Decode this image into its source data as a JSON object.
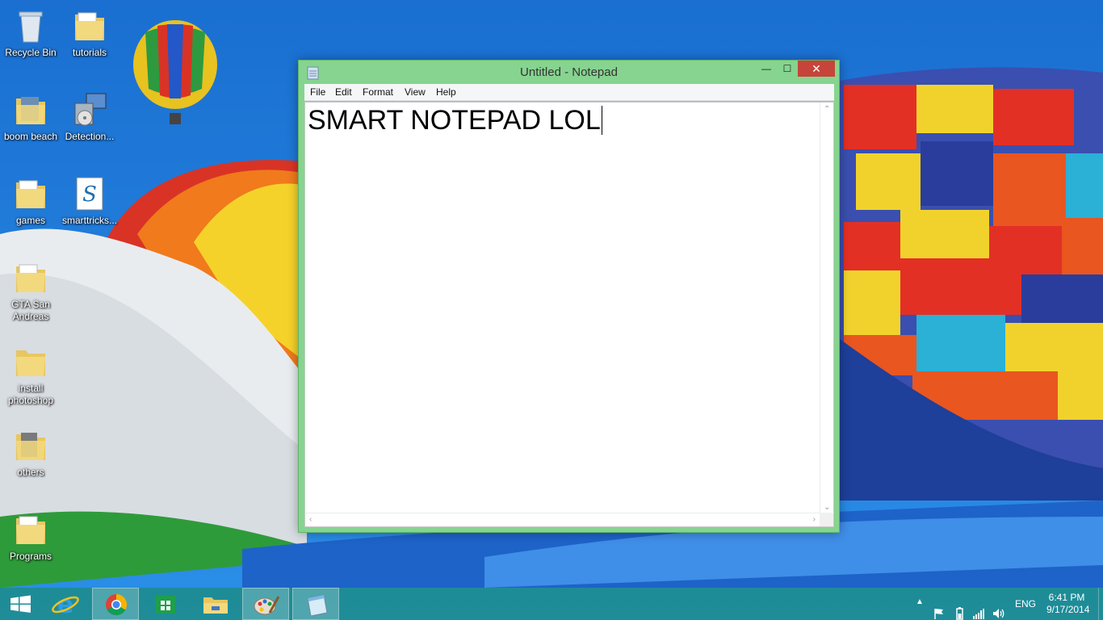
{
  "desktop": {
    "icons": [
      {
        "label": "Recycle Bin",
        "icon": "recycle-bin-icon"
      },
      {
        "label": "tutorials",
        "icon": "folder-icon"
      },
      {
        "label": "boom beach",
        "icon": "folder-icon"
      },
      {
        "label": "Detection...",
        "icon": "setup-icon"
      },
      {
        "label": "games",
        "icon": "folder-icon"
      },
      {
        "label": "smarttricks...",
        "icon": "script-file-icon"
      },
      {
        "label": "GTA San Andreas",
        "icon": "folder-icon"
      },
      {
        "label": "install photoshop",
        "icon": "folder-icon"
      },
      {
        "label": "others",
        "icon": "folder-icon"
      },
      {
        "label": "Programs",
        "icon": "folder-icon"
      }
    ]
  },
  "notepad": {
    "title": "Untitled - Notepad",
    "menu": [
      "File",
      "Edit",
      "Format",
      "View",
      "Help"
    ],
    "content": "SMART NOTEPAD LOL",
    "controls": {
      "minimize": "—",
      "maximize": "☐",
      "close": "✕"
    },
    "frame_color": "#86d48f"
  },
  "taskbar": {
    "pinned": [
      {
        "name": "start",
        "icon": "windows-logo-icon"
      },
      {
        "name": "internet-explorer",
        "icon": "internet-explorer-icon"
      },
      {
        "name": "chrome",
        "icon": "chrome-icon"
      },
      {
        "name": "store",
        "icon": "store-icon"
      },
      {
        "name": "file-explorer",
        "icon": "file-explorer-icon"
      },
      {
        "name": "paint",
        "icon": "paint-icon"
      },
      {
        "name": "notepad",
        "icon": "notepad-icon",
        "active": true
      }
    ],
    "tray": {
      "language": "ENG",
      "time": "6:41 PM",
      "date": "9/17/2014"
    }
  }
}
